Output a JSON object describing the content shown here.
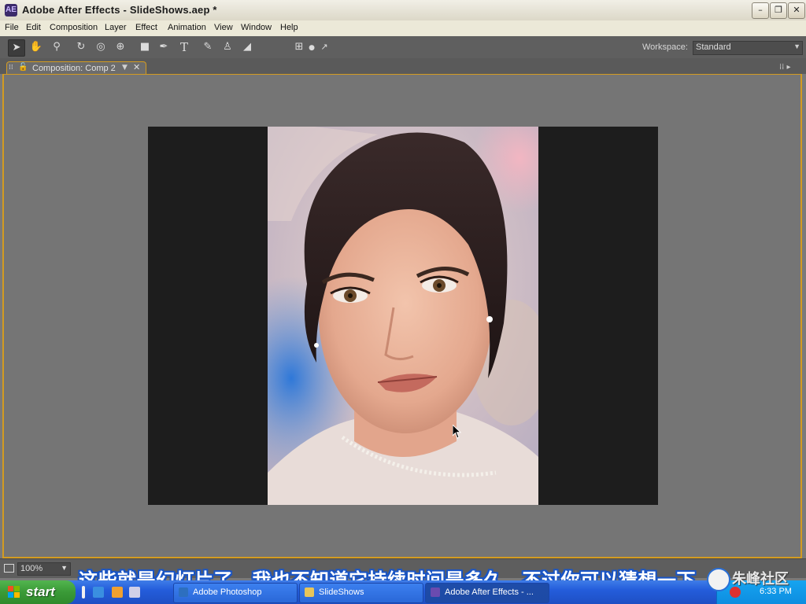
{
  "window": {
    "title": "Adobe After Effects - SlideShows.aep *",
    "app_icon": "AE",
    "controls": [
      "minimize",
      "restore",
      "close"
    ]
  },
  "menubar": {
    "items": [
      "File",
      "Edit",
      "Composition",
      "Layer",
      "Effect",
      "Animation",
      "View",
      "Window",
      "Help"
    ]
  },
  "toolbar": {
    "tools": [
      "selection-tool",
      "hand-tool",
      "zoom-tool",
      "rotation-tool",
      "orbit-camera-tool",
      "pan-behind-tool",
      "rectangle-mask-tool",
      "pen-tool",
      "type-tool",
      "brush-tool",
      "clone-stamp-tool",
      "eraser-tool",
      "local-axis-mode",
      "world-axis-mode",
      "view-axis-mode"
    ],
    "active_tool": "selection-tool",
    "workspace_label": "Workspace:",
    "workspace_value": "Standard"
  },
  "panel": {
    "tab_label": "Composition: Comp 2"
  },
  "viewer": {
    "zoom": "100%"
  },
  "subtitle": "这些就是幻灯片了，我也不知道它持续时间是多久，不过你可以猜想一下",
  "taskbar": {
    "start_label": "start",
    "tasks": [
      {
        "label": "Adobe Photoshop",
        "icon_color": "#2d6fbf"
      },
      {
        "label": "SlideShows",
        "icon_color": "#e8c55a"
      },
      {
        "label": "Adobe After Effects - ...",
        "icon_color": "#6a4bb0"
      }
    ],
    "clock": "6:33 PM"
  },
  "watermark": "朱峰社区",
  "colors": {
    "panel_highlight": "#d39b21",
    "subtitle_outline": "#1a55c4",
    "taskbar_blue": "#245ddb"
  }
}
